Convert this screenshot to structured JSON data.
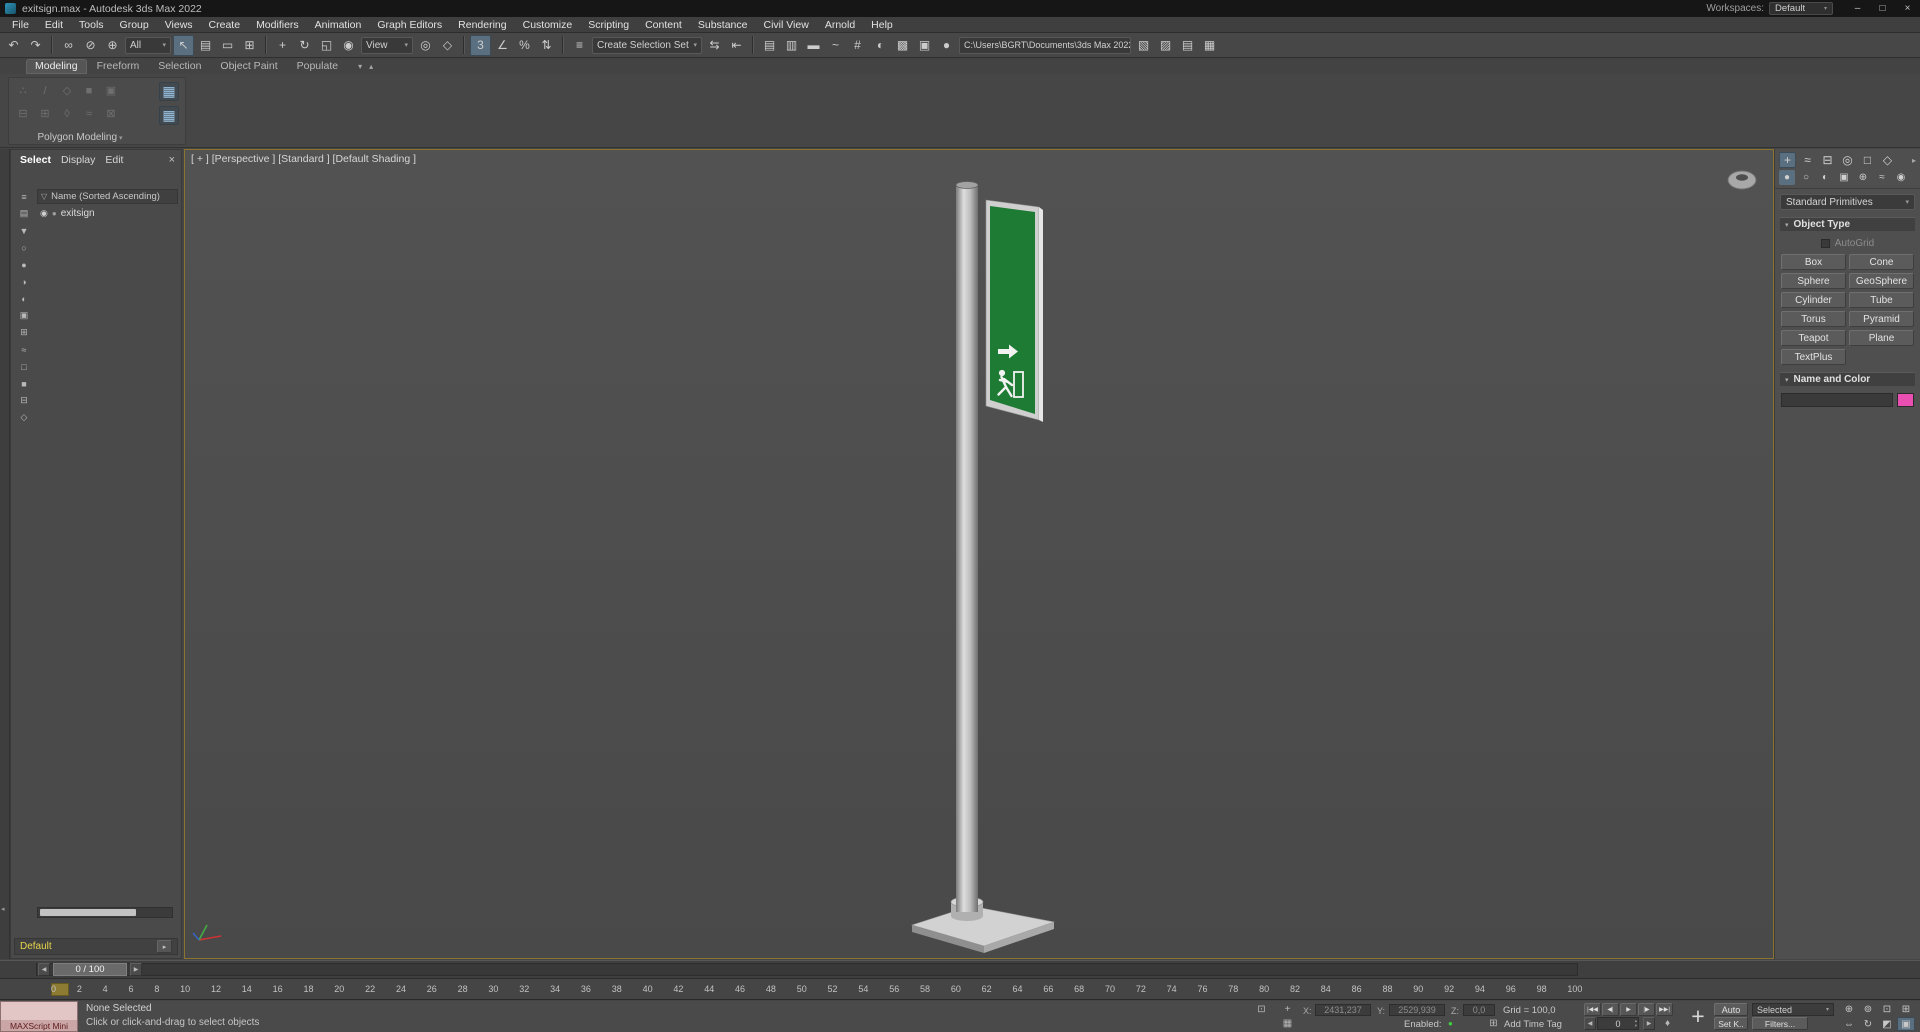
{
  "colors": {
    "sign_green": "#1e7b33",
    "object_color": "#e84fb0",
    "viewport_border": "#8a7430",
    "layer_label": "#e8d44a",
    "enabled_dot": "#3fd23f"
  },
  "window": {
    "title": "exitsign.max - Autodesk 3ds Max 2022",
    "workspaces_label": "Workspaces:",
    "workspaces_value": "Default",
    "controls": {
      "min": "–",
      "max": "□",
      "close": "×"
    }
  },
  "menu": {
    "items": [
      "File",
      "Edit",
      "Tools",
      "Group",
      "Views",
      "Create",
      "Modifiers",
      "Animation",
      "Graph Editors",
      "Rendering",
      "Customize",
      "Scripting",
      "Content",
      "Substance",
      "Civil View",
      "Arnold",
      "Help"
    ]
  },
  "toolbar": {
    "filter_value": "All",
    "coord_value": "View",
    "named_sets_value": "Create Selection Set",
    "project_path": "C:\\Users\\BGRT\\Documents\\3ds Max 2022",
    "g1": [
      {
        "name": "undo-icon",
        "glyph": "↶"
      },
      {
        "name": "redo-icon",
        "glyph": "↷"
      }
    ],
    "g2": [
      {
        "name": "select-and-link-icon",
        "glyph": "∞"
      },
      {
        "name": "unlink-selection-icon",
        "glyph": "⊘"
      },
      {
        "name": "bind-to-space-warp-icon",
        "glyph": "⊕"
      }
    ],
    "g3": [
      {
        "name": "select-object-icon",
        "glyph": "↖",
        "active": true
      },
      {
        "name": "select-by-name-icon",
        "glyph": "▤"
      },
      {
        "name": "rectangular-selection-region-icon",
        "glyph": "▭"
      },
      {
        "name": "window-crossing-icon",
        "glyph": "⊞"
      }
    ],
    "g4": [
      {
        "name": "select-and-move-icon",
        "glyph": "+"
      },
      {
        "name": "select-and-rotate-icon",
        "glyph": "↻"
      },
      {
        "name": "select-and-scale-icon",
        "glyph": "◱"
      },
      {
        "name": "select-and-place-icon",
        "glyph": "◉"
      }
    ],
    "g5": [
      {
        "name": "use-pivot-point-icon",
        "glyph": "◎"
      },
      {
        "name": "select-and-manipulate-icon",
        "glyph": "◇"
      }
    ],
    "g6": [
      {
        "name": "snap-toggle-3d-icon",
        "glyph": "3",
        "active": true
      },
      {
        "name": "angle-snap-icon",
        "glyph": "∠"
      },
      {
        "name": "percent-snap-icon",
        "glyph": "%"
      },
      {
        "name": "spinner-snap-icon",
        "glyph": "⇅"
      }
    ],
    "g7": [
      {
        "name": "edit-named-selection-sets-icon",
        "glyph": "≡"
      }
    ],
    "g8": [
      {
        "name": "mirror-icon",
        "glyph": "⇆"
      },
      {
        "name": "align-icon",
        "glyph": "⇤"
      }
    ],
    "g9": [
      {
        "name": "toggle-scene-explorer-icon",
        "glyph": "▤"
      },
      {
        "name": "toggle-layer-explorer-icon",
        "glyph": "▥"
      },
      {
        "name": "toggle-ribbon-icon",
        "glyph": "▬"
      },
      {
        "name": "curve-editor-icon",
        "glyph": "~"
      },
      {
        "name": "schematic-view-icon",
        "glyph": "#"
      }
    ],
    "g10": [
      {
        "name": "material-editor-icon",
        "glyph": "◐"
      },
      {
        "name": "render-setup-icon",
        "glyph": "▩"
      },
      {
        "name": "rendered-frame-window-icon",
        "glyph": "▣"
      },
      {
        "name": "render-production-icon",
        "glyph": "●"
      }
    ],
    "g11": [
      {
        "name": "monitor-icon",
        "glyph": "▧"
      },
      {
        "name": "monitor-arrow-icon",
        "glyph": "▨"
      },
      {
        "name": "monitor-gear-icon",
        "glyph": "▤"
      },
      {
        "name": "camera-icon",
        "glyph": "▦"
      }
    ]
  },
  "ribbon": {
    "tabs": [
      {
        "name": "tab-modeling",
        "label": "Modeling",
        "active": true
      },
      {
        "name": "tab-freeform",
        "label": "Freeform"
      },
      {
        "name": "tab-selection",
        "label": "Selection"
      },
      {
        "name": "tab-object-paint",
        "label": "Object Paint"
      },
      {
        "name": "tab-populate",
        "label": "Populate"
      }
    ],
    "extra": [
      {
        "name": "ribbon-config-icon",
        "glyph": "▾"
      },
      {
        "name": "minimize-ribbon-icon",
        "glyph": "▴"
      }
    ],
    "row1": [
      {
        "name": "vertex-mode-icon",
        "glyph": "∴"
      },
      {
        "name": "edge-mode-icon",
        "glyph": "/"
      },
      {
        "name": "border-mode-icon",
        "glyph": "◇"
      },
      {
        "name": "polygon-mode-icon",
        "glyph": "■"
      },
      {
        "name": "element-mode-icon",
        "glyph": "▣"
      }
    ],
    "row2": [
      {
        "name": "collapse-icon",
        "glyph": "⊟"
      },
      {
        "name": "attach-icon",
        "glyph": "⊞"
      },
      {
        "name": "detach-icon",
        "glyph": "◊"
      },
      {
        "name": "smooth-icon",
        "glyph": "≈"
      },
      {
        "name": "slice-icon",
        "glyph": "⊠"
      }
    ],
    "blue": [
      {
        "name": "toggle-command-panel-icon",
        "glyph": "▦"
      },
      {
        "name": "pin-stack-icon",
        "glyph": "▦"
      }
    ],
    "caption": "Polygon Modeling"
  },
  "scene_explorer": {
    "tabs": [
      {
        "name": "tab-select",
        "label": "Select",
        "active": true
      },
      {
        "name": "tab-display",
        "label": "Display"
      },
      {
        "name": "tab-edit",
        "label": "Edit"
      }
    ],
    "close_glyph": "×",
    "funnel_glyph": "▽",
    "sort_label": "Name (Sorted Ascending)",
    "row": {
      "eye_glyph": "◉",
      "dot_glyph": "●",
      "label": "exitsign"
    },
    "tools": [
      {
        "name": "explorer-menu-icon",
        "glyph": "≡"
      },
      {
        "name": "list-view-icon",
        "glyph": "▤"
      },
      {
        "name": "sort-order-icon",
        "glyph": "▼"
      },
      {
        "name": "hide-none-icon",
        "glyph": "○"
      },
      {
        "name": "show-geometry-icon",
        "glyph": "●"
      },
      {
        "name": "show-shapes-icon",
        "glyph": "◑"
      },
      {
        "name": "show-lights-icon",
        "glyph": "◐"
      },
      {
        "name": "show-cameras-icon",
        "glyph": "▣"
      },
      {
        "name": "show-helpers-icon",
        "glyph": "⊞"
      },
      {
        "name": "show-spacewarps-icon",
        "glyph": "≈"
      },
      {
        "name": "show-groups-icon",
        "glyph": "□"
      },
      {
        "name": "show-xrefs-icon",
        "glyph": "■"
      },
      {
        "name": "collapse-all-icon",
        "glyph": "⊟"
      },
      {
        "name": "pick-parent-icon",
        "glyph": "◇"
      }
    ],
    "layer_label": "Default",
    "layer_btn_glyph": "▸"
  },
  "viewport": {
    "label": "[ + ] [Perspective ] [Standard ] [Default Shading ]"
  },
  "command_panel": {
    "tabs": [
      {
        "name": "create-tab-icon",
        "glyph": "+",
        "active": true
      },
      {
        "name": "modify-tab-icon",
        "glyph": "≈"
      },
      {
        "name": "hierarchy-tab-icon",
        "glyph": "⊟"
      },
      {
        "name": "motion-tab-icon",
        "glyph": "◎"
      },
      {
        "name": "display-tab-icon",
        "glyph": "□"
      },
      {
        "name": "utilities-tab-icon",
        "glyph": "◇"
      }
    ],
    "overflow_glyph": "▸",
    "cats": [
      {
        "name": "geometry-category-icon",
        "glyph": "●",
        "active": true
      },
      {
        "name": "shapes-category-icon",
        "glyph": "○"
      },
      {
        "name": "lights-category-icon",
        "glyph": "◐"
      },
      {
        "name": "cameras-category-icon",
        "glyph": "▣"
      },
      {
        "name": "helpers-category-icon",
        "glyph": "⊕"
      },
      {
        "name": "spacewarps-category-icon",
        "glyph": "≈"
      },
      {
        "name": "systems-category-icon",
        "glyph": "◉"
      }
    ],
    "category": "Standard Primitives",
    "object_type": {
      "title": "Object Type",
      "autogrid_label": "AutoGrid",
      "buttons": [
        "Box",
        "Cone",
        "Sphere",
        "GeoSphere",
        "Cylinder",
        "Tube",
        "Torus",
        "Pyramid",
        "Teapot",
        "Plane",
        "TextPlus"
      ]
    },
    "name_color_title": "Name and Color"
  },
  "timeline": {
    "slider_label": "0 / 100",
    "nudge_left": "◀",
    "nudge_right": "▶",
    "ticks": [
      "0",
      "2",
      "4",
      "6",
      "8",
      "10",
      "12",
      "14",
      "16",
      "18",
      "20",
      "22",
      "24",
      "26",
      "28",
      "30",
      "32",
      "34",
      "36",
      "38",
      "40",
      "42",
      "44",
      "46",
      "48",
      "50",
      "52",
      "54",
      "56",
      "58",
      "60",
      "62",
      "64",
      "66",
      "68",
      "70",
      "72",
      "74",
      "76",
      "78",
      "80",
      "82",
      "84",
      "86",
      "88",
      "90",
      "92",
      "94",
      "96",
      "98",
      "100"
    ]
  },
  "status": {
    "maxscript_label": "MAXScript Mini",
    "line1": "None Selected",
    "line2": "Click or click-and-drag to select objects",
    "lock_glyph": "⊡",
    "typein_glyph": "+",
    "time_config_glyph": "▦",
    "tag_glyph": "⊞",
    "key_glyph": "♦",
    "plus_glyph": "+",
    "x_label": "X:",
    "x_value": "2431,237",
    "y_label": "Y:",
    "y_value": "2529,939",
    "z_label": "Z:",
    "z_value": "0,0",
    "grid_label": "Grid = 100,0",
    "enabled_label": "Enabled:",
    "dot_glyph": "●",
    "add_time_tag": "Add Time Tag",
    "playback": [
      {
        "name": "go-to-start-button",
        "glyph": "|◀◀"
      },
      {
        "name": "previous-frame-button",
        "glyph": "◀|"
      },
      {
        "name": "play-button",
        "glyph": "▶"
      },
      {
        "name": "next-frame-button",
        "glyph": "|▶"
      },
      {
        "name": "go-to-end-button",
        "glyph": "▶▶|"
      }
    ],
    "frame_value": "0",
    "spin_up": "▴",
    "spin_down": "▾",
    "auto_label": "Auto",
    "selected_label": "Selected",
    "setkey_label": "Set K..",
    "filters_label": "Filters...",
    "nav1": [
      {
        "name": "zoom-icon",
        "glyph": "⊕"
      },
      {
        "name": "zoom-all-icon",
        "glyph": "⊚"
      },
      {
        "name": "zoom-extents-icon",
        "glyph": "⊡"
      },
      {
        "name": "zoom-region-icon",
        "glyph": "⊞"
      }
    ],
    "nav2": [
      {
        "name": "pan-icon",
        "glyph": "⇔"
      },
      {
        "name": "orbit-icon",
        "glyph": "↻"
      },
      {
        "name": "field-of-view-icon",
        "glyph": "◩"
      },
      {
        "name": "maximize-viewport-toggle-icon",
        "glyph": "▣",
        "active": true
      }
    ]
  }
}
